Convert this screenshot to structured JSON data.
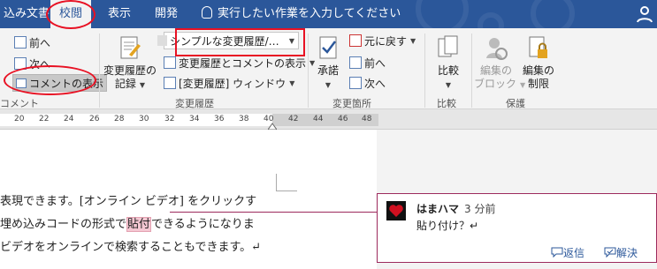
{
  "tabs": {
    "insert_trunc": "込み文書",
    "review": "校閲",
    "view": "表示",
    "dev": "開発"
  },
  "tellme": {
    "placeholder": "実行したい作業を入力してください"
  },
  "comments_group": {
    "next_label": "前へ",
    "prev_label": "次へ",
    "show_label": "コメントの表示",
    "group_label": "コメント"
  },
  "tracking": {
    "review_pane": "変更履歴の\n記録",
    "display_mode": "シンプルな変更履歴/…",
    "show_markup": "変更履歴とコメントの表示",
    "window": "[変更履歴] ウィンドウ",
    "record_line1": "変更履歴の",
    "record_line2": "記録",
    "group_label": "変更履歴"
  },
  "changes": {
    "accept_line1": "承諾",
    "reject": "元に戻す",
    "prev": "前へ",
    "next": "次へ",
    "group_label": "変更箇所"
  },
  "compare": {
    "label": "比較",
    "group_label": "比較"
  },
  "protect": {
    "block_line1": "編集の",
    "block_line2": "ブロック",
    "restrict_line1": "編集の",
    "restrict_line2": "制限",
    "group_label": "保護"
  },
  "ruler": {
    "ticks": [
      "20",
      "22",
      "24",
      "26",
      "28",
      "30",
      "32",
      "34",
      "36",
      "38",
      "40",
      "42",
      "44",
      "46",
      "48"
    ]
  },
  "document": {
    "line1": "表現できます。[オンライン ビデオ] をクリックす",
    "line2_pre": "埋め込みコードの形式で",
    "line2_hl": "貼付",
    "line2_post": "できるようになりま",
    "line3": "ビデオをオンラインで検索することもできます。↵"
  },
  "comment": {
    "author": "はまハマ",
    "time": "3 分前",
    "text": "貼り付け？↵",
    "reply": "返信",
    "resolve": "解決"
  }
}
